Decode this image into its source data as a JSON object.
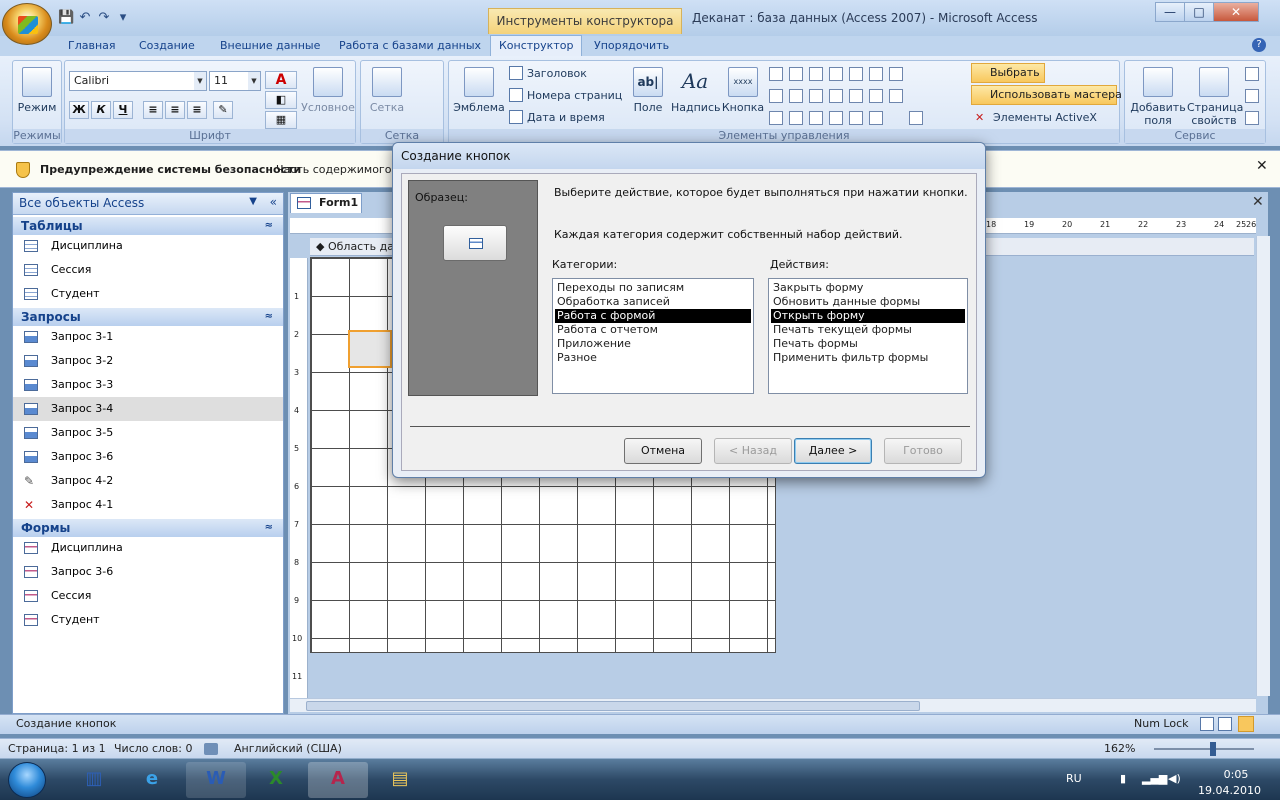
{
  "window": {
    "title": "Деканат : база данных (Access 2007) - Microsoft Access",
    "context_tab": "Инструменты конструктора форм",
    "controls": {
      "minimize": "—",
      "maximize": "□",
      "close": "✕"
    }
  },
  "ribbon": {
    "tabs": [
      "Главная",
      "Создание",
      "Внешние данные",
      "Работа с базами данных",
      "Конструктор",
      "Упорядочить"
    ],
    "active_tab": "Конструктор",
    "groups": {
      "views": {
        "label": "Режимы",
        "mode": "Режим"
      },
      "font": {
        "label": "Шрифт",
        "font_name": "Calibri",
        "font_size": "11",
        "bold": "Ж",
        "italic": "К",
        "underline": "Ч",
        "conditional": "Условное",
        "font_color_glyph": "A"
      },
      "grid": {
        "label": "Сетка",
        "grid_button": "Сетка"
      },
      "controls": {
        "label": "Элементы управления",
        "emblem": "Эмблема",
        "heading": "Заголовок",
        "page_numbers": "Номера страниц",
        "date_time": "Дата и время",
        "field": "Поле",
        "caption": "Надпись",
        "button": "Кнопка",
        "field_glyph": "ab|",
        "caption_glyph": "Aa",
        "button_glyph": "xxxx",
        "select": "Выбрать",
        "use_wizards": "Использовать мастера",
        "activex": "Элементы ActiveX"
      },
      "tools": {
        "label": "Сервис",
        "add_fields": "Добавить поля",
        "property_sheet": "Страница свойств"
      }
    }
  },
  "security_bar": {
    "warning": "Предупреждение системы безопасности",
    "text": "Часть содержимого б"
  },
  "nav_pane": {
    "header": "Все объекты Access",
    "sections": [
      {
        "title": "Таблицы",
        "items": [
          "Дисциплина",
          "Сессия",
          "Студент"
        ]
      },
      {
        "title": "Запросы",
        "items": [
          "Запрос 3-1",
          "Запрос 3-2",
          "Запрос 3-3",
          "Запрос 3-4",
          "Запрос 3-5",
          "Запрос 3-6",
          "Запрос 4-2",
          "Запрос 4-1"
        ]
      },
      {
        "title": "Формы",
        "items": [
          "Дисциплина",
          "Запрос 3-6",
          "Сессия",
          "Студент"
        ]
      }
    ],
    "selected_item": "Запрос 3-4"
  },
  "document": {
    "tab": "Form1",
    "section": "Область данных",
    "ruler_left": [
      "1",
      "2",
      "3",
      "4",
      "5",
      "6",
      "7",
      "8",
      "9",
      "10",
      "11"
    ],
    "ruler_top_right": [
      "18",
      "19",
      "20",
      "21",
      "22",
      "23",
      "24",
      "25",
      "26"
    ]
  },
  "dialog": {
    "title": "Создание кнопок",
    "sample_label": "Образец:",
    "instruction": "Выберите действие, которое будет выполняться при нажатии кнопки.",
    "note": "Каждая категория содержит собственный набор действий.",
    "categories_label": "Категории:",
    "categories": [
      "Переходы по записям",
      "Обработка записей",
      "Работа с формой",
      "Работа с отчетом",
      "Приложение",
      "Разное"
    ],
    "selected_category": "Работа с формой",
    "actions_label": "Действия:",
    "actions": [
      "Закрыть форму",
      "Обновить данные формы",
      "Открыть форму",
      "Печать текущей формы",
      "Печать формы",
      "Применить фильтр формы"
    ],
    "selected_action": "Открыть форму",
    "buttons": {
      "cancel": "Отмена",
      "back": "< Назад",
      "next": "Далее >",
      "finish": "Готово"
    }
  },
  "status": {
    "left": "Создание кнопок",
    "num_lock": "Num Lock"
  },
  "word_status": {
    "page": "Страница: 1 из 1",
    "words": "Число слов: 0",
    "language": "Английский (США)",
    "zoom": "162%"
  },
  "taskbar": {
    "lang": "RU",
    "time": "0:05",
    "date": "19.04.2010"
  },
  "colors": {
    "accent": "#f8c75d",
    "ribbon": "#d4e2f4",
    "selection": "#000000"
  }
}
